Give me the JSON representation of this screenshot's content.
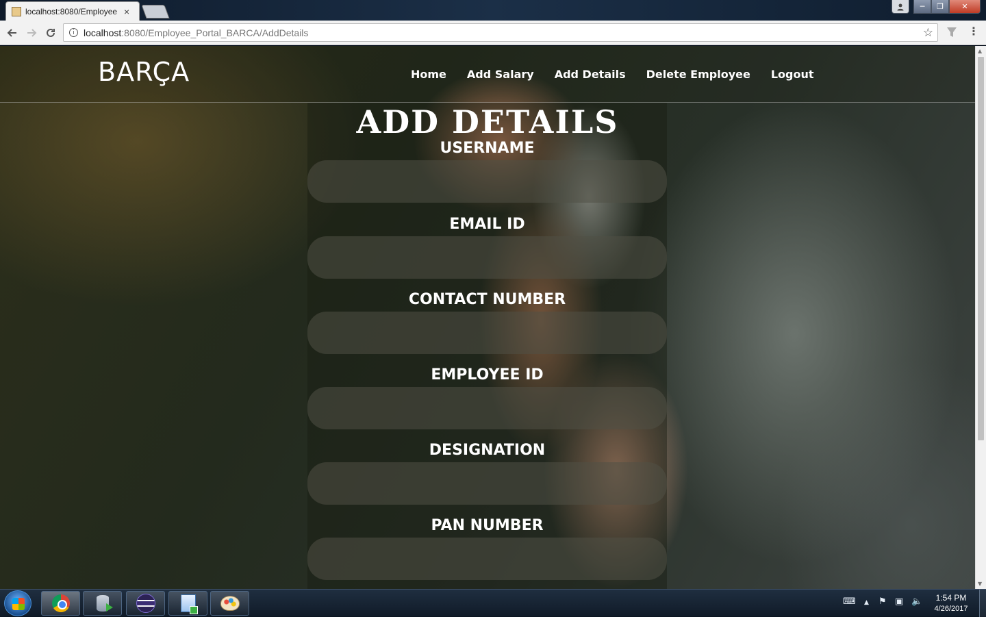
{
  "browser": {
    "tab_title": "localhost:8080/Employee",
    "tab_close": "×",
    "url_host": "localhost",
    "url_rest": ":8080/Employee_Portal_BARCA/AddDetails",
    "info_glyph": "i",
    "star_glyph": "☆"
  },
  "window_controls": {
    "minimize": "─",
    "maximize": "❐",
    "close": "✕"
  },
  "site": {
    "brand": "BARÇA",
    "nav": [
      "Home",
      "Add Salary",
      "Add Details",
      "Delete Employee",
      "Logout"
    ]
  },
  "form": {
    "title": "ADD DETAILS",
    "fields": [
      {
        "label": "USERNAME",
        "value": ""
      },
      {
        "label": "EMAIL ID",
        "value": ""
      },
      {
        "label": "CONTACT NUMBER",
        "value": ""
      },
      {
        "label": "EMPLOYEE ID",
        "value": ""
      },
      {
        "label": "DESIGNATION",
        "value": ""
      },
      {
        "label": "PAN NUMBER",
        "value": ""
      }
    ]
  },
  "taskbar": {
    "time": "1:54 PM",
    "date": "4/26/2017",
    "items": [
      "chrome-icon",
      "db-run-icon",
      "eclipse-icon",
      "document-icon",
      "paint-icon"
    ]
  },
  "colors": {
    "accent_text": "#ffffff",
    "input_bg": "rgba(80,80,70,0.55)",
    "taskbar_bg": "#101b28"
  }
}
